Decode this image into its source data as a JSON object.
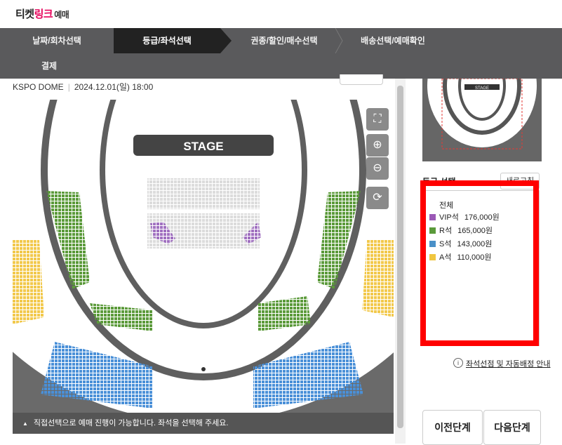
{
  "brand": {
    "part1": "티켓",
    "part2": "링크",
    "part3": "예매"
  },
  "steps": [
    {
      "label": "날짜/회차선택",
      "active": false
    },
    {
      "label": "등급/좌석선택",
      "active": true
    },
    {
      "label": "권종/할인/매수선택",
      "active": false
    },
    {
      "label": "배송선택/예매확인",
      "active": false
    },
    {
      "label": "결제",
      "active": false
    }
  ],
  "event": {
    "venue": "KSPO DOME",
    "datetime": "2024.12.01(일) 18:00"
  },
  "map": {
    "stage_label": "STAGE",
    "footer_text": "직접선택으로 예매 진행이 가능합니다. 좌석을 선택해 주세요.",
    "tools": {
      "fit": "fit-screen-icon",
      "zoom_in": "zoom-in-icon",
      "zoom_out": "zoom-out-icon",
      "reset": "refresh-icon"
    }
  },
  "minimap": {
    "stage_label": "STAGE"
  },
  "grade": {
    "heading": "등급 선택",
    "refresh_label": "새로고침",
    "all_label": "전체",
    "items": [
      {
        "name": "VIP석",
        "price": "176,000원",
        "color": "#9b59b6"
      },
      {
        "name": "R석",
        "price": "165,000원",
        "color": "#5a9a3a"
      },
      {
        "name": "S석",
        "price": "143,000원",
        "color": "#4a90c8"
      },
      {
        "name": "A석",
        "price": "110,000원",
        "color": "#f0c640"
      }
    ]
  },
  "guide": {
    "label": "좌석선점 및 자동배정 안내"
  },
  "buttons": {
    "prev": "이전단계",
    "next": "다음단계"
  }
}
